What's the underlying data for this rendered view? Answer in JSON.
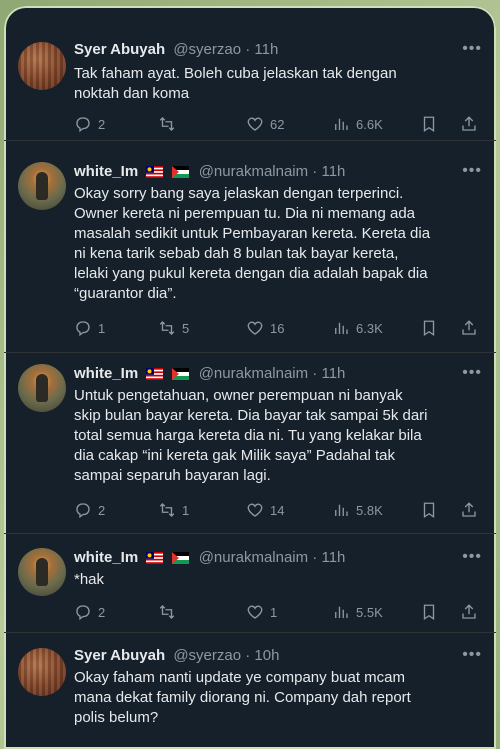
{
  "tweets": [
    {
      "name": "Syer Abuyah",
      "handle": "@syerzao · 11h",
      "text": "Tak faham ayat. Boleh cuba jelaskan tak dengan\nnoktah dan koma",
      "replies": "2",
      "retweets": "",
      "likes": "62",
      "views": "6.6K",
      "avatar": "brick-wall-avatar"
    },
    {
      "name": "white_Im",
      "handle": "@nurakmalnaim · 11h",
      "text": "Okay sorry bang saya jelaskan dengan terperinci.\nOwner kereta ni perempuan tu. Dia ni memang ada\nmasalah sedikit untuk Pembayaran kereta. Kereta dia\nni kena tarik sebab dah 8 bulan tak bayar kereta,\nlelaki yang pukul kereta dengan dia adalah bapak dia\n“guarantor dia”.",
      "replies": "1",
      "retweets": "5",
      "likes": "16",
      "views": "6.3K",
      "avatar": "person-avatar"
    },
    {
      "name": "white_Im",
      "handle": "@nurakmalnaim · 11h",
      "text": "Untuk pengetahuan, owner perempuan ni banyak\nskip bulan bayar kereta. Dia bayar tak sampai 5k dari\ntotal semua harga kereta dia ni. Tu yang kelakar bila\ndia cakap “ini kereta gak Milik saya” Padahal tak\nsampai separuh bayaran lagi.",
      "replies": "2",
      "retweets": "1",
      "likes": "14",
      "views": "5.8K",
      "avatar": "person-avatar"
    },
    {
      "name": "white_Im",
      "handle": "@nurakmalnaim · 11h",
      "text": "*hak",
      "replies": "2",
      "retweets": "",
      "likes": "1",
      "views": "5.5K",
      "avatar": "person-avatar"
    },
    {
      "name": "Syer Abuyah",
      "handle": "@syerzao · 10h",
      "text": "Okay faham nanti update ye company buat mcam\nmana dekat family diorang ni. Company dah report\npolis belum?",
      "avatar": "brick-wall-avatar"
    }
  ],
  "icons": {
    "reply": "reply-icon",
    "retweet": "retweet-icon",
    "like": "heart-icon",
    "views": "views-icon",
    "bookmark": "bookmark-icon",
    "share": "share-icon",
    "more": "more-icon",
    "flag1": "malaysia-flag-icon",
    "flag2": "palestine-flag-icon"
  },
  "colors": {
    "background": "#15202b",
    "text": "#e7e9ea",
    "muted": "#8b98a5"
  }
}
